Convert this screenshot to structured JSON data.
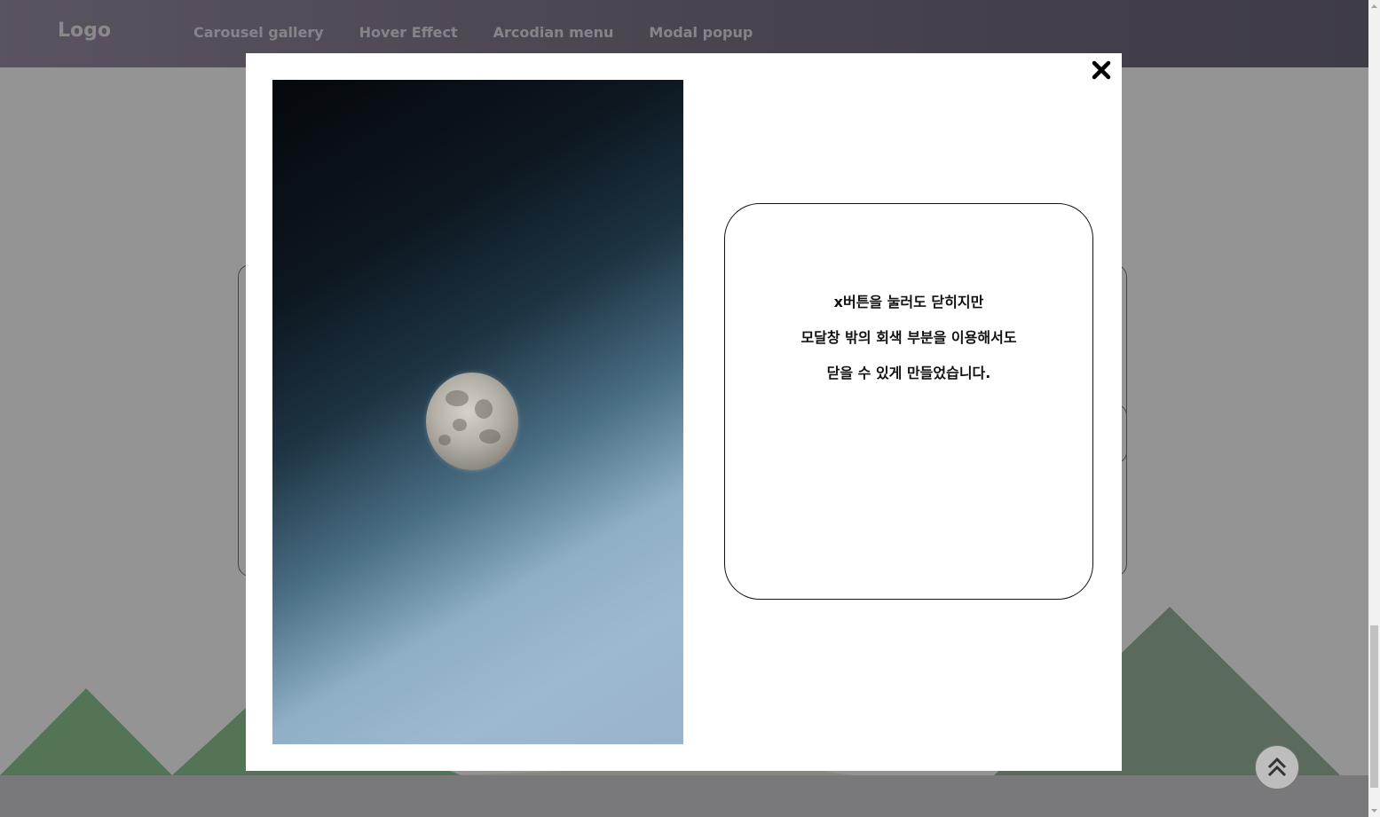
{
  "header": {
    "logo": "Logo",
    "nav": [
      "Carousel gallery",
      "Hover Effect",
      "Arcodian menu",
      "Modal popup"
    ]
  },
  "modal": {
    "lines": [
      "x버튼을 눌러도 닫히지만",
      "모달창 밖의 회색 부분을 이용해서도",
      "닫을 수 있게 만들었습니다."
    ],
    "close_icon": "close-x-icon",
    "image_subject": "moon-in-space"
  },
  "back_to_top": {
    "icon": "double-chevron-up-icon"
  },
  "colors": {
    "header_start": "#9c8fa6",
    "header_end": "#6c6878",
    "overlay": "rgba(0,0,0,0.42)",
    "mountain_green": "#5f8a63",
    "modal_bg": "#ffffff"
  }
}
